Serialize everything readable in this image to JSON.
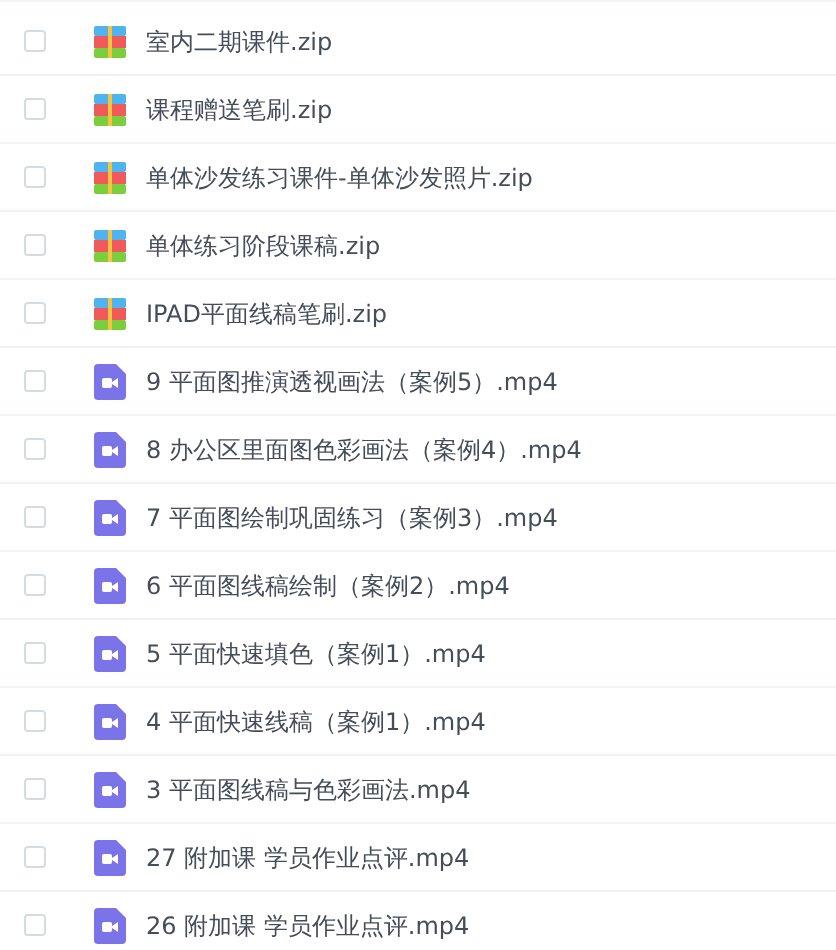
{
  "files": [
    {
      "name": "室内二期课件.zip",
      "kind": "zip",
      "checked": false
    },
    {
      "name": "课程赠送笔刷.zip",
      "kind": "zip",
      "checked": false
    },
    {
      "name": "单体沙发练习课件-单体沙发照片.zip",
      "kind": "zip",
      "checked": false
    },
    {
      "name": "单体练习阶段课稿.zip",
      "kind": "zip",
      "checked": false
    },
    {
      "name": "IPAD平面线稿笔刷.zip",
      "kind": "zip",
      "checked": false
    },
    {
      "name": "9 平面图推演透视画法（案例5）.mp4",
      "kind": "video",
      "checked": false
    },
    {
      "name": "8 办公区里面图色彩画法（案例4）.mp4",
      "kind": "video",
      "checked": false
    },
    {
      "name": "7 平面图绘制巩固练习（案例3）.mp4",
      "kind": "video",
      "checked": false
    },
    {
      "name": "6 平面图线稿绘制（案例2）.mp4",
      "kind": "video",
      "checked": false
    },
    {
      "name": "5 平面快速填色（案例1）.mp4",
      "kind": "video",
      "checked": false
    },
    {
      "name": "4 平面快速线稿（案例1）.mp4",
      "kind": "video",
      "checked": false
    },
    {
      "name": "3 平面图线稿与色彩画法.mp4",
      "kind": "video",
      "checked": false
    },
    {
      "name": "27 附加课 学员作业点评.mp4",
      "kind": "video",
      "checked": false
    },
    {
      "name": "26 附加课 学员作业点评.mp4",
      "kind": "video",
      "checked": false
    }
  ]
}
